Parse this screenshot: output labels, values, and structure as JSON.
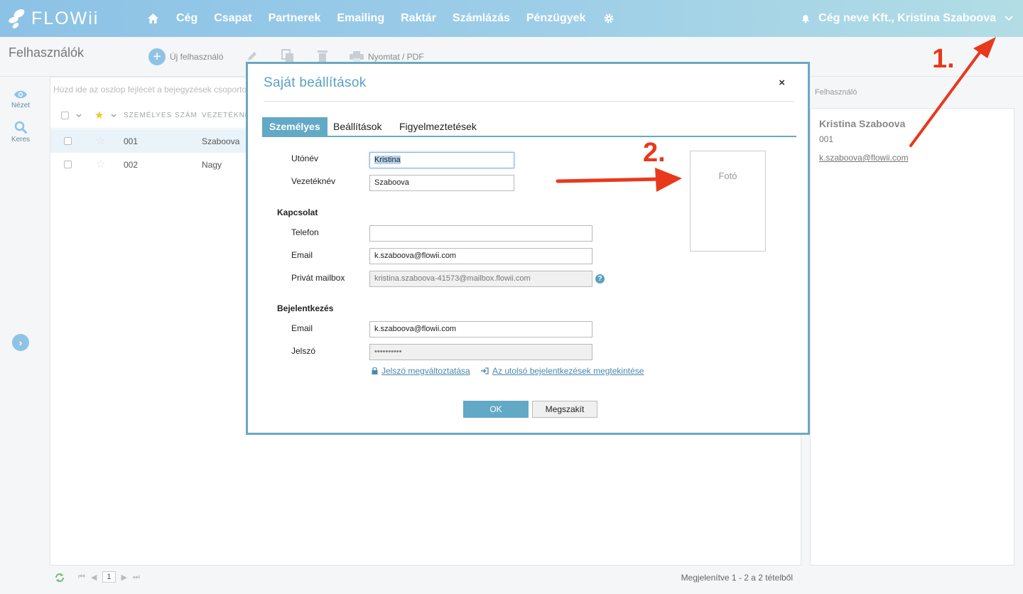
{
  "brand": {
    "name": "FLOWii",
    "accent": "#62a9c6"
  },
  "nav": {
    "items": [
      "Cég",
      "Csapat",
      "Partnerek",
      "Emailing",
      "Raktár",
      "Számlázás",
      "Pénzügyek"
    ],
    "user_label": "Cég neve Kft., Kristina Szaboova"
  },
  "toolbar": {
    "page_title": "Felhasználók",
    "new_user": "Új felhasználó",
    "print": "Nyomtat / PDF"
  },
  "rail": {
    "view": "Nézet",
    "search": "Keres"
  },
  "grid": {
    "group_hint": "Húzd ide az oszlop fejlécét a bejegyzések csoportosításához",
    "columns": [
      "SZEMÉLYES SZÁM",
      "VEZETÉKNÉV"
    ],
    "rows": [
      {
        "number": "001",
        "lastname": "Szaboova"
      },
      {
        "number": "002",
        "lastname": "Nagy"
      }
    ],
    "page": "1",
    "footer_info": "Megjelenítve 1 - 2 a 2 tételből"
  },
  "sidepanel": {
    "title": "Felhasználó",
    "name": "Kristina Szaboova",
    "number": "001",
    "email": "k.szaboova@flowii.com"
  },
  "modal": {
    "title": "Saját beállítások",
    "close": "×",
    "tabs": [
      "Személyes",
      "Beállítások",
      "Figyelmeztetések"
    ],
    "firstname_label": "Utónév",
    "firstname_value": "Kristina",
    "lastname_label": "Vezetéknév",
    "lastname_value": "Szaboova",
    "contact_section": "Kapcsolat",
    "phone_label": "Telefon",
    "phone_value": "",
    "email_label": "Email",
    "email_value": "k.szaboova@flowii.com",
    "mailbox_label": "Privát mailbox",
    "mailbox_value": "kristina.szaboova-41573@mailbox.flowii.com",
    "login_section": "Bejelentkezés",
    "login_email_label": "Email",
    "login_email_value": "k.szaboova@flowii.com",
    "password_label": "Jelszó",
    "password_value": "••••••••••",
    "change_password": "Jelszó megváltoztatása",
    "last_logins": "Az utolsó bejelentkezések megtekintése",
    "photo": "Fotó",
    "ok": "OK",
    "cancel": "Megszakít"
  },
  "annotations": {
    "step1": "1.",
    "step2": "2.",
    "color": "#e8391d"
  }
}
